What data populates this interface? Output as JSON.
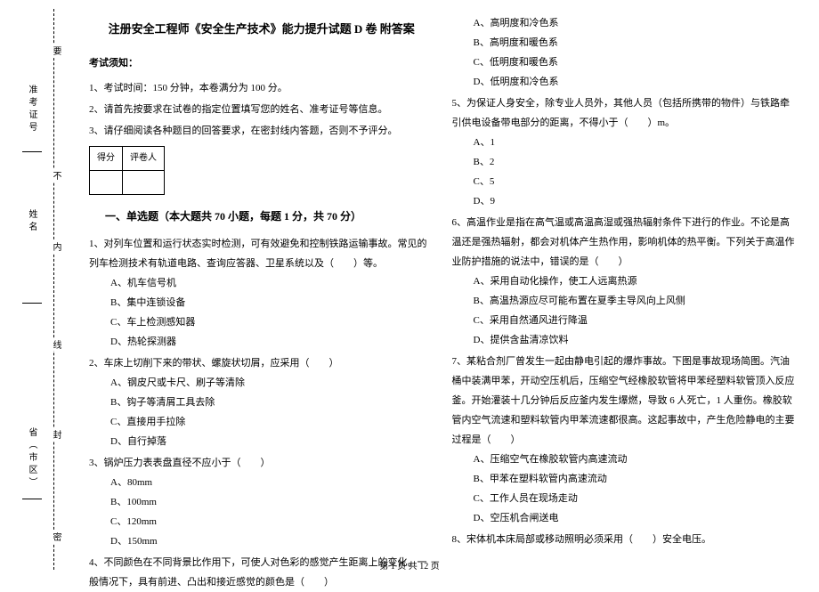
{
  "title": "注册安全工程师《安全生产技术》能力提升试题 D 卷  附答案",
  "notice_heading": "考试须知：",
  "notices": [
    "1、考试时间：150 分钟，本卷满分为 100 分。",
    "2、请首先按要求在试卷的指定位置填写您的姓名、准考证号等信息。",
    "3、请仔细阅读各种题目的回答要求，在密封线内答题，否则不予评分。"
  ],
  "score_table": {
    "c1": "得分",
    "c2": "评卷人"
  },
  "section1_title": "一、单选题（本大题共 70 小题，每题 1 分，共 70 分）",
  "q1": {
    "stem": "1、对列车位置和运行状态实时检测，可有效避免和控制铁路运输事故。常见的列车检测技术有轨道电路、查询应答器、卫星系统以及（　　）等。",
    "A": "A、机车信号机",
    "B": "B、集中连锁设备",
    "C": "C、车上检测感知器",
    "D": "D、热轮探测器"
  },
  "q2": {
    "stem": "2、车床上切削下来的带状、螺旋状切屑，应采用（　　）",
    "A": "A、钢皮尺或卡尺、刷子等清除",
    "B": "B、钩子等清屑工具去除",
    "C": "C、直接用手拉除",
    "D": "D、自行掉落"
  },
  "q3": {
    "stem": "3、锅炉压力表表盘直径不应小于（　　）",
    "A": "A、80mm",
    "B": "B、100mm",
    "C": "C、120mm",
    "D": "D、150mm"
  },
  "q4": {
    "stem": "4、不同颜色在不同背景比作用下，可使人对色彩的感觉产生距离上的变化。一般情况下，具有前进、凸出和接近感觉的颜色是（　　）"
  },
  "q4_opts": {
    "A": "A、高明度和冷色系",
    "B": "B、高明度和暖色系",
    "C": "C、低明度和暖色系",
    "D": "D、低明度和冷色系"
  },
  "q5": {
    "stem": "5、为保证人身安全，除专业人员外，其他人员（包括所携带的物件）与铁路牵引供电设备带电部分的距离，不得小于（　　）m。",
    "A": "A、1",
    "B": "B、2",
    "C": "C、5",
    "D": "D、9"
  },
  "q6": {
    "stem": "6、高温作业是指在高气温或高温高湿或强热辐射条件下进行的作业。不论是高温还是强热辐射，都会对机体产生热作用，影响机体的热平衡。下列关于高温作业防护措施的说法中，错误的是（　　）",
    "A": "A、采用自动化操作，使工人远离热源",
    "B": "B、高温热源应尽可能布置在夏季主导风向上风侧",
    "C": "C、采用自然通风进行降温",
    "D": "D、提供含盐清凉饮料"
  },
  "q7": {
    "stem": "7、某粘合剂厂曾发生一起由静电引起的爆炸事故。下图是事故现场简图。汽油桶中装满甲苯，开动空压机后，压缩空气经橡胶软管将甲苯经塑料软管顶入反应釜。开始灌装十几分钟后反应釜内发生爆燃，导致 6 人死亡，1 人重伤。橡胶软管内空气流速和塑料软管内甲苯流速都很高。这起事故中，产生危险静电的主要过程是（　　）",
    "A": "A、压缩空气在橡胶软管内高速流动",
    "B": "B、甲苯在塑料软管内高速流动",
    "C": "C、工作人员在现场走动",
    "D": "D、空压机合闸送电"
  },
  "q8": {
    "stem": "8、宋体机本床局部或移动照明必须采用（　　）安全电压。"
  },
  "margin_labels": {
    "id_no": "准考证号",
    "name": "姓名",
    "province": "省（市区）"
  },
  "dash_labels": {
    "d1": "密",
    "d2": "封",
    "d3": "线",
    "d4": "内",
    "d5": "不",
    "d6": "要"
  },
  "footer": "第 1 页 共 12 页"
}
